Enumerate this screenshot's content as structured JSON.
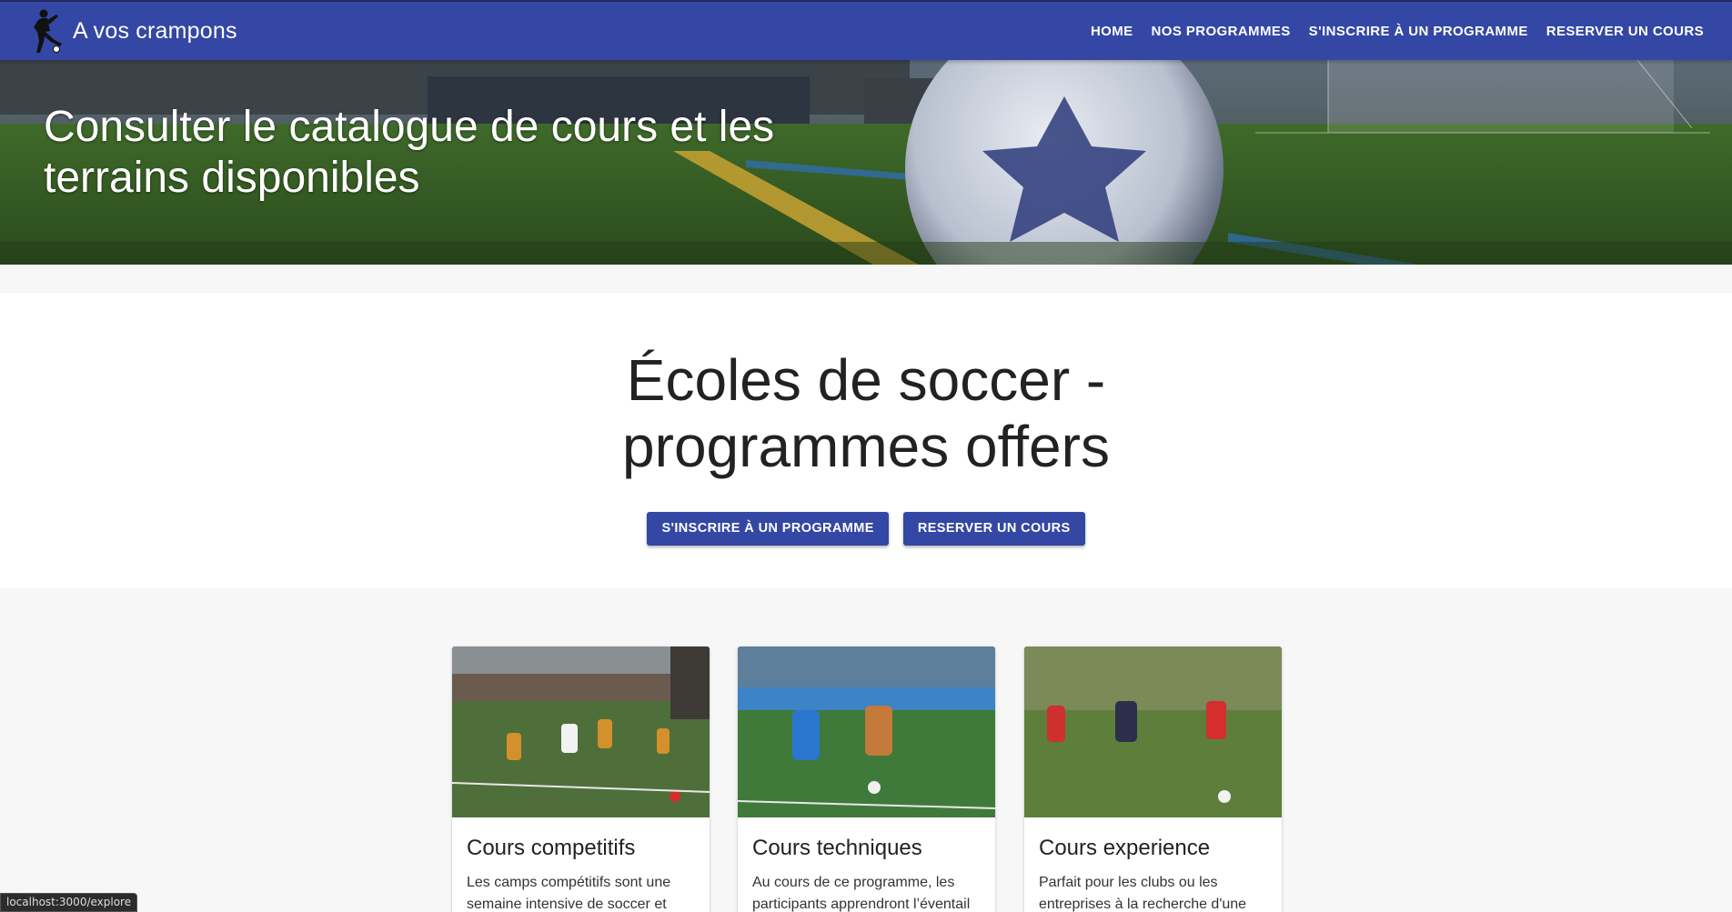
{
  "app": {
    "title": "A vos crampons",
    "logo_icon": "soccer-player-icon"
  },
  "nav": {
    "items": [
      "HOME",
      "NOS PROGRAMMES",
      "S'INSCRIRE À UN PROGRAMME",
      "RESERVER UN COURS"
    ]
  },
  "hero": {
    "title": "Consulter le catalogue de cours et les terrains disponibles"
  },
  "intro": {
    "heading_line1": "Écoles de soccer -",
    "heading_line2": "programmes offers",
    "buttons": [
      "S'INSCRIRE À UN PROGRAMME",
      "RESERVER UN COURS"
    ]
  },
  "cards": [
    {
      "title": "Cours competitifs",
      "text": "Les camps compétitifs sont une semaine intensive de soccer et"
    },
    {
      "title": "Cours techniques",
      "text": "Au cours de ce programme, les participants apprendront l’éventail"
    },
    {
      "title": "Cours experience",
      "text": "Parfait pour les clubs ou les entreprises à la recherche d'une"
    }
  ],
  "status": {
    "url": "localhost:3000/explore"
  },
  "colors": {
    "primary": "#3447a5",
    "background": "#f7f7f7"
  }
}
